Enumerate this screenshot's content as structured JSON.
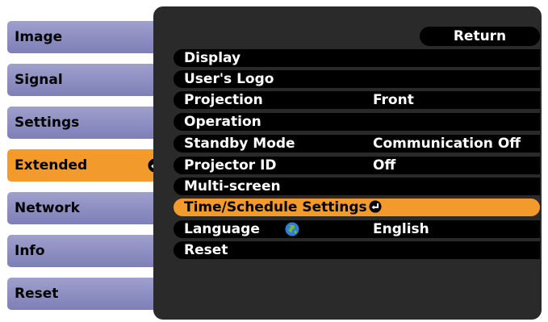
{
  "left_menu": {
    "items": [
      {
        "label": "Image"
      },
      {
        "label": "Signal"
      },
      {
        "label": "Settings"
      },
      {
        "label": "Extended",
        "active": true
      },
      {
        "label": "Network"
      },
      {
        "label": "Info"
      },
      {
        "label": "Reset"
      }
    ]
  },
  "submenu": {
    "return_label": "Return",
    "rows": [
      {
        "label": "Display",
        "value": ""
      },
      {
        "label": "User's Logo",
        "value": ""
      },
      {
        "label": "Projection",
        "value": "Front"
      },
      {
        "label": "Operation",
        "value": ""
      },
      {
        "label": "Standby Mode",
        "value": "Communication Off"
      },
      {
        "label": "Projector ID",
        "value": "Off"
      },
      {
        "label": "Multi-screen",
        "value": ""
      },
      {
        "label": "Time/Schedule Settings",
        "value": "",
        "selected": true
      },
      {
        "label": "Language",
        "value": "English",
        "icon": "globe-icon"
      },
      {
        "label": "Reset",
        "value": ""
      }
    ]
  },
  "colors": {
    "tab": "#8f91c4",
    "active": "#f39a2c",
    "panel": "#2a2a2a",
    "row": "#000000"
  }
}
